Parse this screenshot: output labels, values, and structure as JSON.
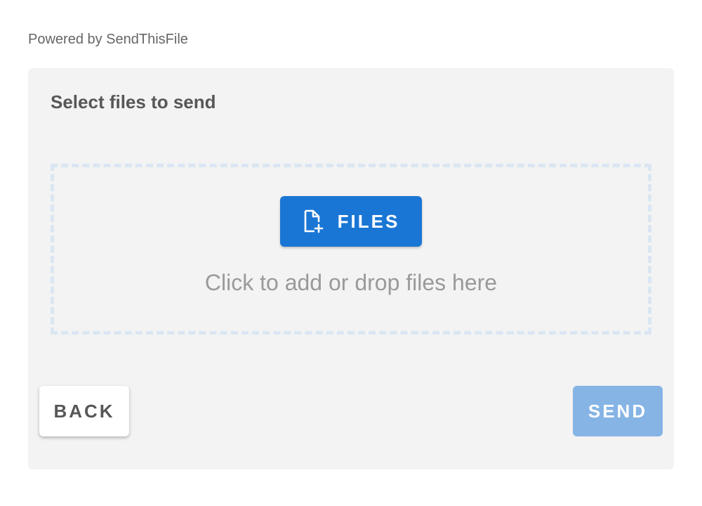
{
  "powered_by": "Powered by SendThisFile",
  "panel": {
    "title": "Select files to send"
  },
  "dropzone": {
    "button_label": "FILES",
    "button_icon": "file-add-icon",
    "hint": "Click to add or drop files here"
  },
  "actions": {
    "back_label": "BACK",
    "send_label": "SEND",
    "send_disabled": true
  },
  "colors": {
    "primary": "#1a76d4",
    "primary_disabled": "#85b4e5",
    "panel_bg": "#f3f3f3",
    "dropzone_border": "#dae6f2"
  }
}
